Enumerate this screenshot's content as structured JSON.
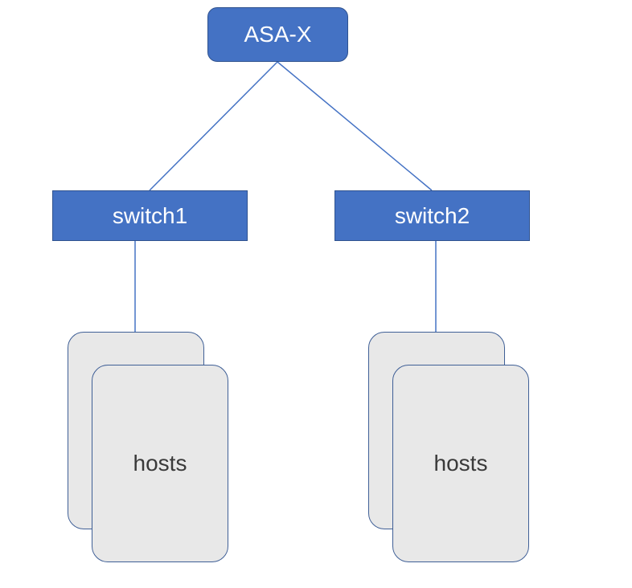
{
  "diagram": {
    "root": {
      "label": "ASA-X"
    },
    "switches": [
      {
        "label": "switch1"
      },
      {
        "label": "switch2"
      }
    ],
    "hostGroups": [
      {
        "label": "hosts"
      },
      {
        "label": "hosts"
      }
    ]
  },
  "colors": {
    "nodeFill": "#4472C4",
    "nodeBorder": "#2F528F",
    "cardFill": "#E8E8E8",
    "cardBorder": "#3F5F96",
    "connector": "#4472C4"
  }
}
